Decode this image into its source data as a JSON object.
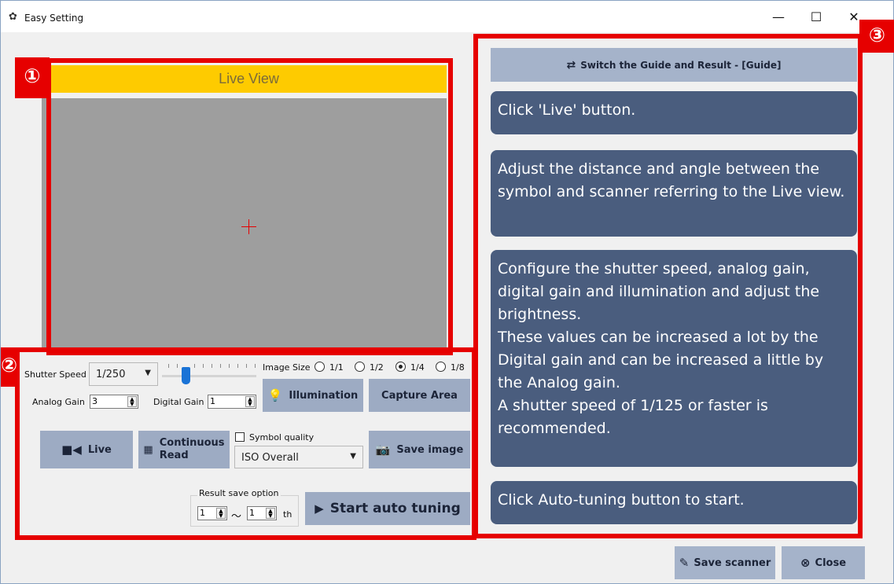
{
  "window": {
    "title": "Easy Setting",
    "title_icon": "gear-icon",
    "minimize": "—",
    "maximize": "☐",
    "close": "✕"
  },
  "callouts": {
    "one": "①",
    "two": "②",
    "three": "③"
  },
  "live_view": {
    "header": "Live View"
  },
  "controls": {
    "shutter_speed_label": "Shutter Speed",
    "shutter_speed_value": "1/250",
    "image_size_label": "Image Size",
    "image_size_options": [
      "1/1",
      "1/2",
      "1/4",
      "1/8"
    ],
    "image_size_selected": "1/4",
    "analog_gain_label": "Analog Gain",
    "analog_gain_value": "3",
    "digital_gain_label": "Digital Gain",
    "digital_gain_value": "1",
    "illumination_label": "Illumination",
    "capture_area_label": "Capture Area",
    "live_label": "Live",
    "continuous_read_line1": "Continuous",
    "continuous_read_line2": "Read",
    "symbol_quality_label": "Symbol quality",
    "symbol_quality_checked": false,
    "symbol_standard_value": "ISO Overall",
    "save_image_label": "Save image",
    "result_save_option_label": "Result save option",
    "result_from": "1",
    "result_range_sep": "～",
    "result_to": "1",
    "result_suffix": "th",
    "start_auto_tuning_label": "Start auto tuning"
  },
  "guide": {
    "switch_label": "Switch the Guide and Result - [Guide]",
    "steps": [
      "Click 'Live' button.",
      "Adjust the distance and angle between the symbol and scanner referring to the Live view.",
      "Configure the shutter speed, analog gain, digital gain and illumination and adjust the brightness.\nThese values can be increased a lot by the Digital gain and can be increased a little by the Analog gain.\nA shutter speed of 1/125 or faster is recommended.",
      "Click Auto-tuning button to start."
    ]
  },
  "footer": {
    "save_scanner_label": "Save scanner",
    "close_label": "Close"
  },
  "colors": {
    "highlight_red": "#e60000",
    "live_header_yellow": "#fecb00",
    "button_blue_grey": "#9dabc3",
    "guide_card": "#4a5d7e",
    "slider_blue": "#1a73d6"
  }
}
